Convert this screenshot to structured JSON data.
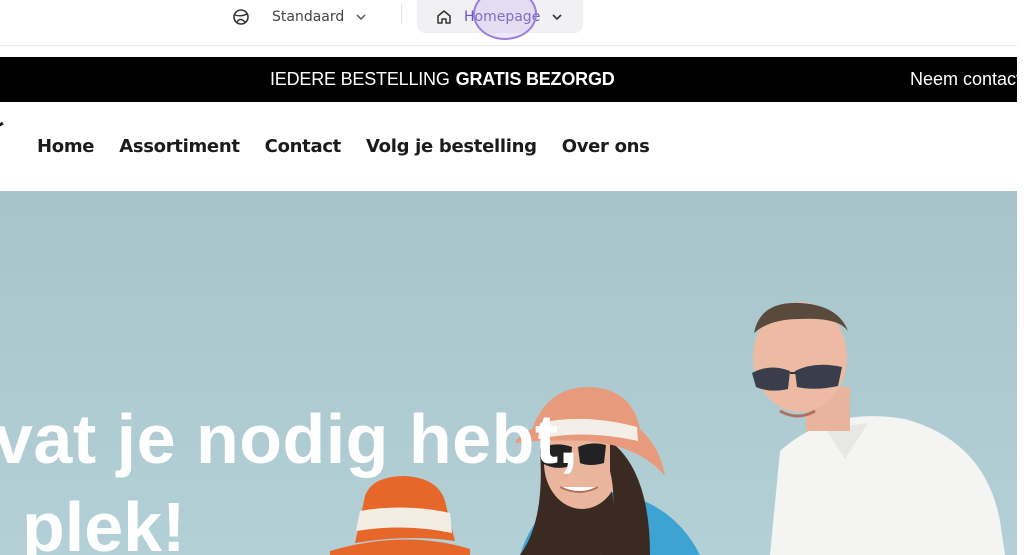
{
  "toolbar": {
    "theme_label": "Standaard",
    "theme_icon": "palette-icon",
    "page_label": "Homepage",
    "page_icon": "home-icon"
  },
  "announcement": {
    "main_prefix": "IEDERE BESTELLING",
    "main_bold": "GRATIS BEZORGD",
    "right_text": "Neem contact"
  },
  "nav": {
    "items": [
      {
        "label": "Home"
      },
      {
        "label": "Assortiment"
      },
      {
        "label": "Contact"
      },
      {
        "label": "Volg je bestelling"
      },
      {
        "label": "Over ons"
      }
    ]
  },
  "hero": {
    "line1": "vat je nodig hebt,",
    "line2": "plek!"
  },
  "colors": {
    "announcement_bg": "#000000",
    "hero_bg": "#a9c6cc",
    "cursor_accent": "#9a7fe0"
  }
}
